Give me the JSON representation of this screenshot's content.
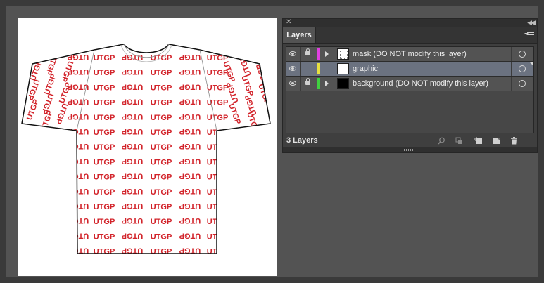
{
  "artwork": {
    "pattern_text": "UTGP",
    "pattern_color": "#d2232a"
  },
  "layers_panel": {
    "tab_label": "Layers",
    "close_icon": "close-icon",
    "collapse_icon": "double-chevron-left-icon",
    "menu_icon": "panel-menu-icon",
    "layers": [
      {
        "name": "mask (DO NOT modify this layer)",
        "color": "#e040e0",
        "visible": true,
        "locked": true,
        "expandable": true,
        "thumbnail": "mask",
        "selected": false
      },
      {
        "name": "graphic",
        "color": "#e8e040",
        "visible": true,
        "locked": false,
        "expandable": false,
        "thumbnail": "white",
        "selected": true
      },
      {
        "name": "background (DO NOT modify this layer)",
        "color": "#40d040",
        "visible": true,
        "locked": true,
        "expandable": true,
        "thumbnail": "black",
        "selected": false
      }
    ],
    "footer": {
      "count_label": "3 Layers",
      "icons": [
        "locate-object-icon",
        "make-clipping-mask-icon",
        "create-sublayer-icon",
        "create-new-layer-icon",
        "delete-layer-icon"
      ]
    }
  }
}
